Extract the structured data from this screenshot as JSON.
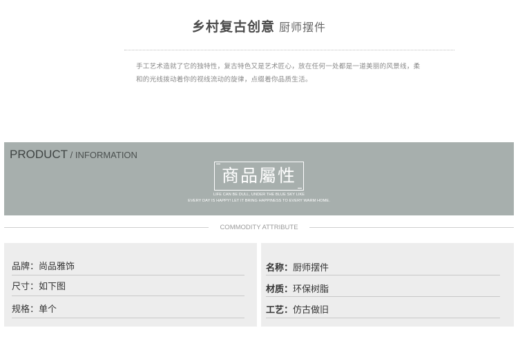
{
  "header": {
    "title_bold": "乡村复古创意",
    "title_light": "厨师摆件",
    "intro_line1": "手工艺术造就了它的独特性，复古特色又是艺术匠心，放在任何一处都是一道美丽的风景线，柔",
    "intro_line2": "和的光线拨动着你的视线流动的旋律，点缀着你品质生活。"
  },
  "banner": {
    "product": "PRODUCT",
    "information": " / INFORMATION",
    "chinese_title": "商品屬性",
    "tagline1": "LIFE CAN BE DULL, UNDER THE BLUE SKY LIKE",
    "tagline2": "EVERY DAY IS HAPPY! LET IT BRING HAPPINESS TO EVERY WARM HOME.",
    "color": "#a7afad"
  },
  "divider": {
    "label": "COMMODITY ATTRIBUTE"
  },
  "attributes": {
    "left": [
      {
        "key": "品牌：",
        "value": "尚品雅饰"
      },
      {
        "key": "尺寸：",
        "value": "如下图"
      },
      {
        "key": "规格：",
        "value": "单个"
      }
    ],
    "right": [
      {
        "key": "名称：",
        "value": "厨师摆件"
      },
      {
        "key": "材质：",
        "value": "环保树脂"
      },
      {
        "key": "工艺：",
        "value": "仿古做旧"
      }
    ]
  }
}
